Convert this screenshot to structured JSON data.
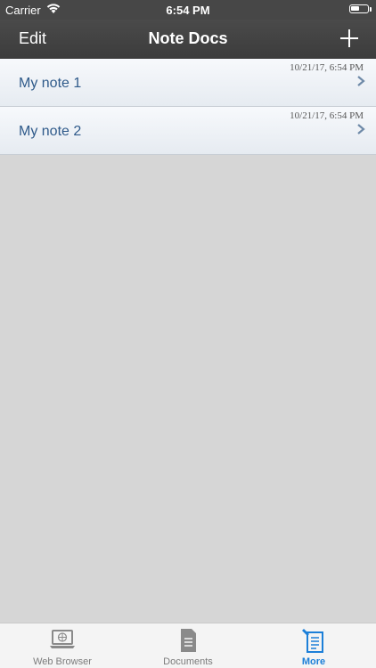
{
  "status_bar": {
    "carrier": "Carrier",
    "time": "6:54 PM"
  },
  "nav": {
    "edit_label": "Edit",
    "title": "Note Docs",
    "add_icon": "plus-icon"
  },
  "notes": [
    {
      "title": "My note 1",
      "date": "10/21/17, 6:54 PM"
    },
    {
      "title": "My note 2",
      "date": "10/21/17, 6:54 PM"
    }
  ],
  "tabs": [
    {
      "label": "Web Browser",
      "icon": "laptop-globe-icon",
      "active": false
    },
    {
      "label": "Documents",
      "icon": "document-icon",
      "active": false
    },
    {
      "label": "More",
      "icon": "note-pencil-icon",
      "active": true
    }
  ],
  "colors": {
    "nav_bg": "#444444",
    "note_title": "#2f5a8a",
    "active_tab": "#1c7fd8",
    "content_bg": "#d6d6d6"
  }
}
